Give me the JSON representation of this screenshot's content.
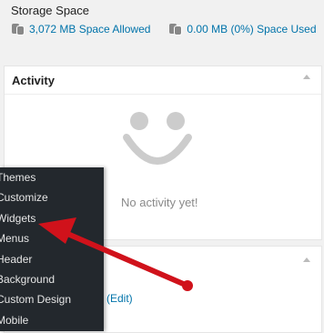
{
  "storage": {
    "title": "Storage Space",
    "allowed": "3,072 MB Space Allowed",
    "used": "0.00 MB (0%) Space Used"
  },
  "activity": {
    "title": "Activity",
    "empty_text": "No activity yet!"
  },
  "panel2": {
    "edit_text": "(Edit)"
  },
  "menu": {
    "items": [
      "Themes",
      "Customize",
      "Widgets",
      "Menus",
      "Header",
      "Background",
      "Custom Design",
      "Mobile"
    ]
  },
  "colors": {
    "link": "#0073aa",
    "menu_bg": "#23282d",
    "arrow": "#d0121b"
  }
}
